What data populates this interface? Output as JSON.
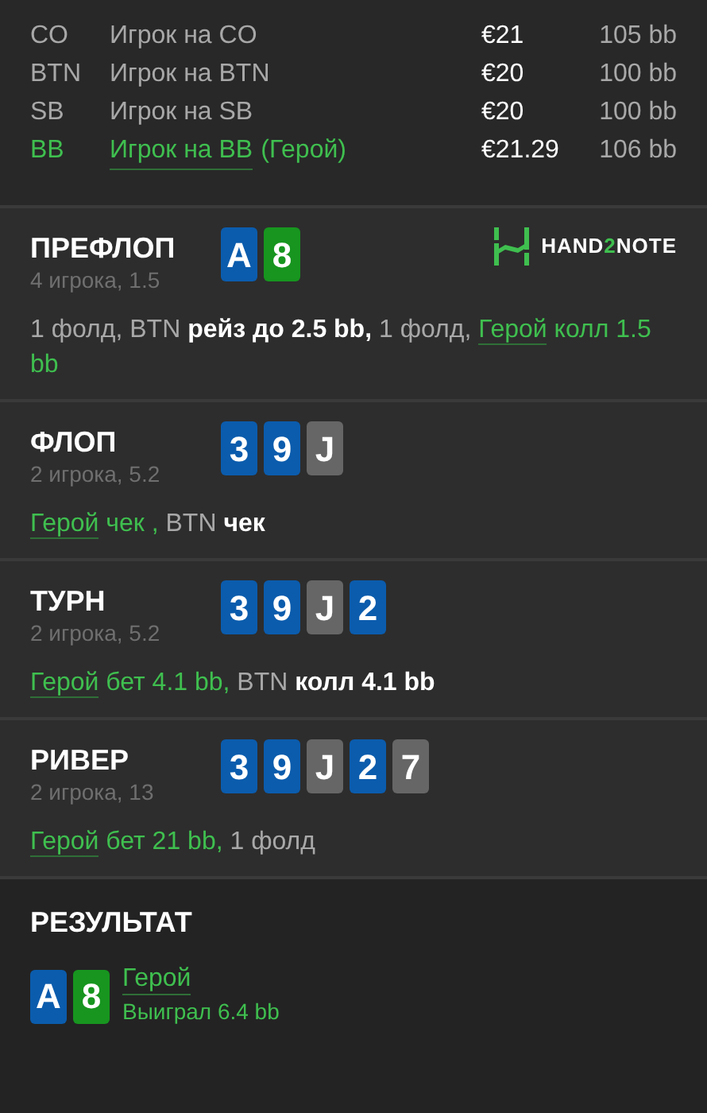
{
  "players": [
    {
      "position": "CO",
      "name": "Игрок на CO",
      "stack": "€21",
      "bb": "105 bb",
      "hero": false
    },
    {
      "position": "BTN",
      "name": "Игрок на BTN",
      "stack": "€20",
      "bb": "100 bb",
      "hero": false
    },
    {
      "position": "SB",
      "name": "Игрок на SB",
      "stack": "€20",
      "bb": "100 bb",
      "hero": false
    },
    {
      "position": "BB",
      "name": "Игрок на BB",
      "note": "(Герой)",
      "stack": "€21.29",
      "bb": "106 bb",
      "hero": true
    }
  ],
  "logo": {
    "before": "HAND",
    "accent": "2",
    "after": "NOTE"
  },
  "streets": [
    {
      "title": "ПРЕФЛОП",
      "subtitle": "4 игрока, 1.5",
      "cards": [
        {
          "rank": "A",
          "color": "#0b5cad"
        },
        {
          "rank": "8",
          "color": "#17951f"
        }
      ],
      "logo": true,
      "actions": [
        {
          "kind": "plain",
          "text": "1 фолд, BTN "
        },
        {
          "kind": "strong",
          "text": "рейз до 2.5 bb,"
        },
        {
          "kind": "plain",
          "text": " 1 фолд, "
        },
        {
          "kind": "hero",
          "text": "Герой"
        },
        {
          "kind": "green",
          "text": " колл 1.5 bb"
        }
      ]
    },
    {
      "title": "ФЛОП",
      "subtitle": "2 игрока, 5.2",
      "cards": [
        {
          "rank": "3",
          "color": "#0b5cad"
        },
        {
          "rank": "9",
          "color": "#0b5cad"
        },
        {
          "rank": "J",
          "color": "#666666"
        }
      ],
      "logo": false,
      "actions": [
        {
          "kind": "hero",
          "text": "Герой"
        },
        {
          "kind": "green",
          "text": " чек , "
        },
        {
          "kind": "plain",
          "text": "BTN "
        },
        {
          "kind": "strong",
          "text": "чек"
        }
      ]
    },
    {
      "title": "ТУРН",
      "subtitle": "2 игрока, 5.2",
      "cards": [
        {
          "rank": "3",
          "color": "#0b5cad"
        },
        {
          "rank": "9",
          "color": "#0b5cad"
        },
        {
          "rank": "J",
          "color": "#666666"
        },
        {
          "rank": "2",
          "color": "#0b5cad"
        }
      ],
      "logo": false,
      "actions": [
        {
          "kind": "hero",
          "text": "Герой"
        },
        {
          "kind": "green",
          "text": " бет 4.1 bb,"
        },
        {
          "kind": "plain",
          "text": " BTN "
        },
        {
          "kind": "strong",
          "text": "колл 4.1 bb"
        }
      ]
    },
    {
      "title": "РИВЕР",
      "subtitle": "2 игрока, 13",
      "cards": [
        {
          "rank": "3",
          "color": "#0b5cad"
        },
        {
          "rank": "9",
          "color": "#0b5cad"
        },
        {
          "rank": "J",
          "color": "#666666"
        },
        {
          "rank": "2",
          "color": "#0b5cad"
        },
        {
          "rank": "7",
          "color": "#666666"
        }
      ],
      "logo": false,
      "actions": [
        {
          "kind": "hero",
          "text": "Герой"
        },
        {
          "kind": "green",
          "text": " бет 21 bb,"
        },
        {
          "kind": "plain",
          "text": " 1 фолд"
        }
      ]
    }
  ],
  "result": {
    "title": "РЕЗУЛЬТАТ",
    "cards": [
      {
        "rank": "A",
        "color": "#0b5cad"
      },
      {
        "rank": "8",
        "color": "#17951f"
      }
    ],
    "player": "Герой",
    "outcome": "Выиграл 6.4 bb"
  }
}
